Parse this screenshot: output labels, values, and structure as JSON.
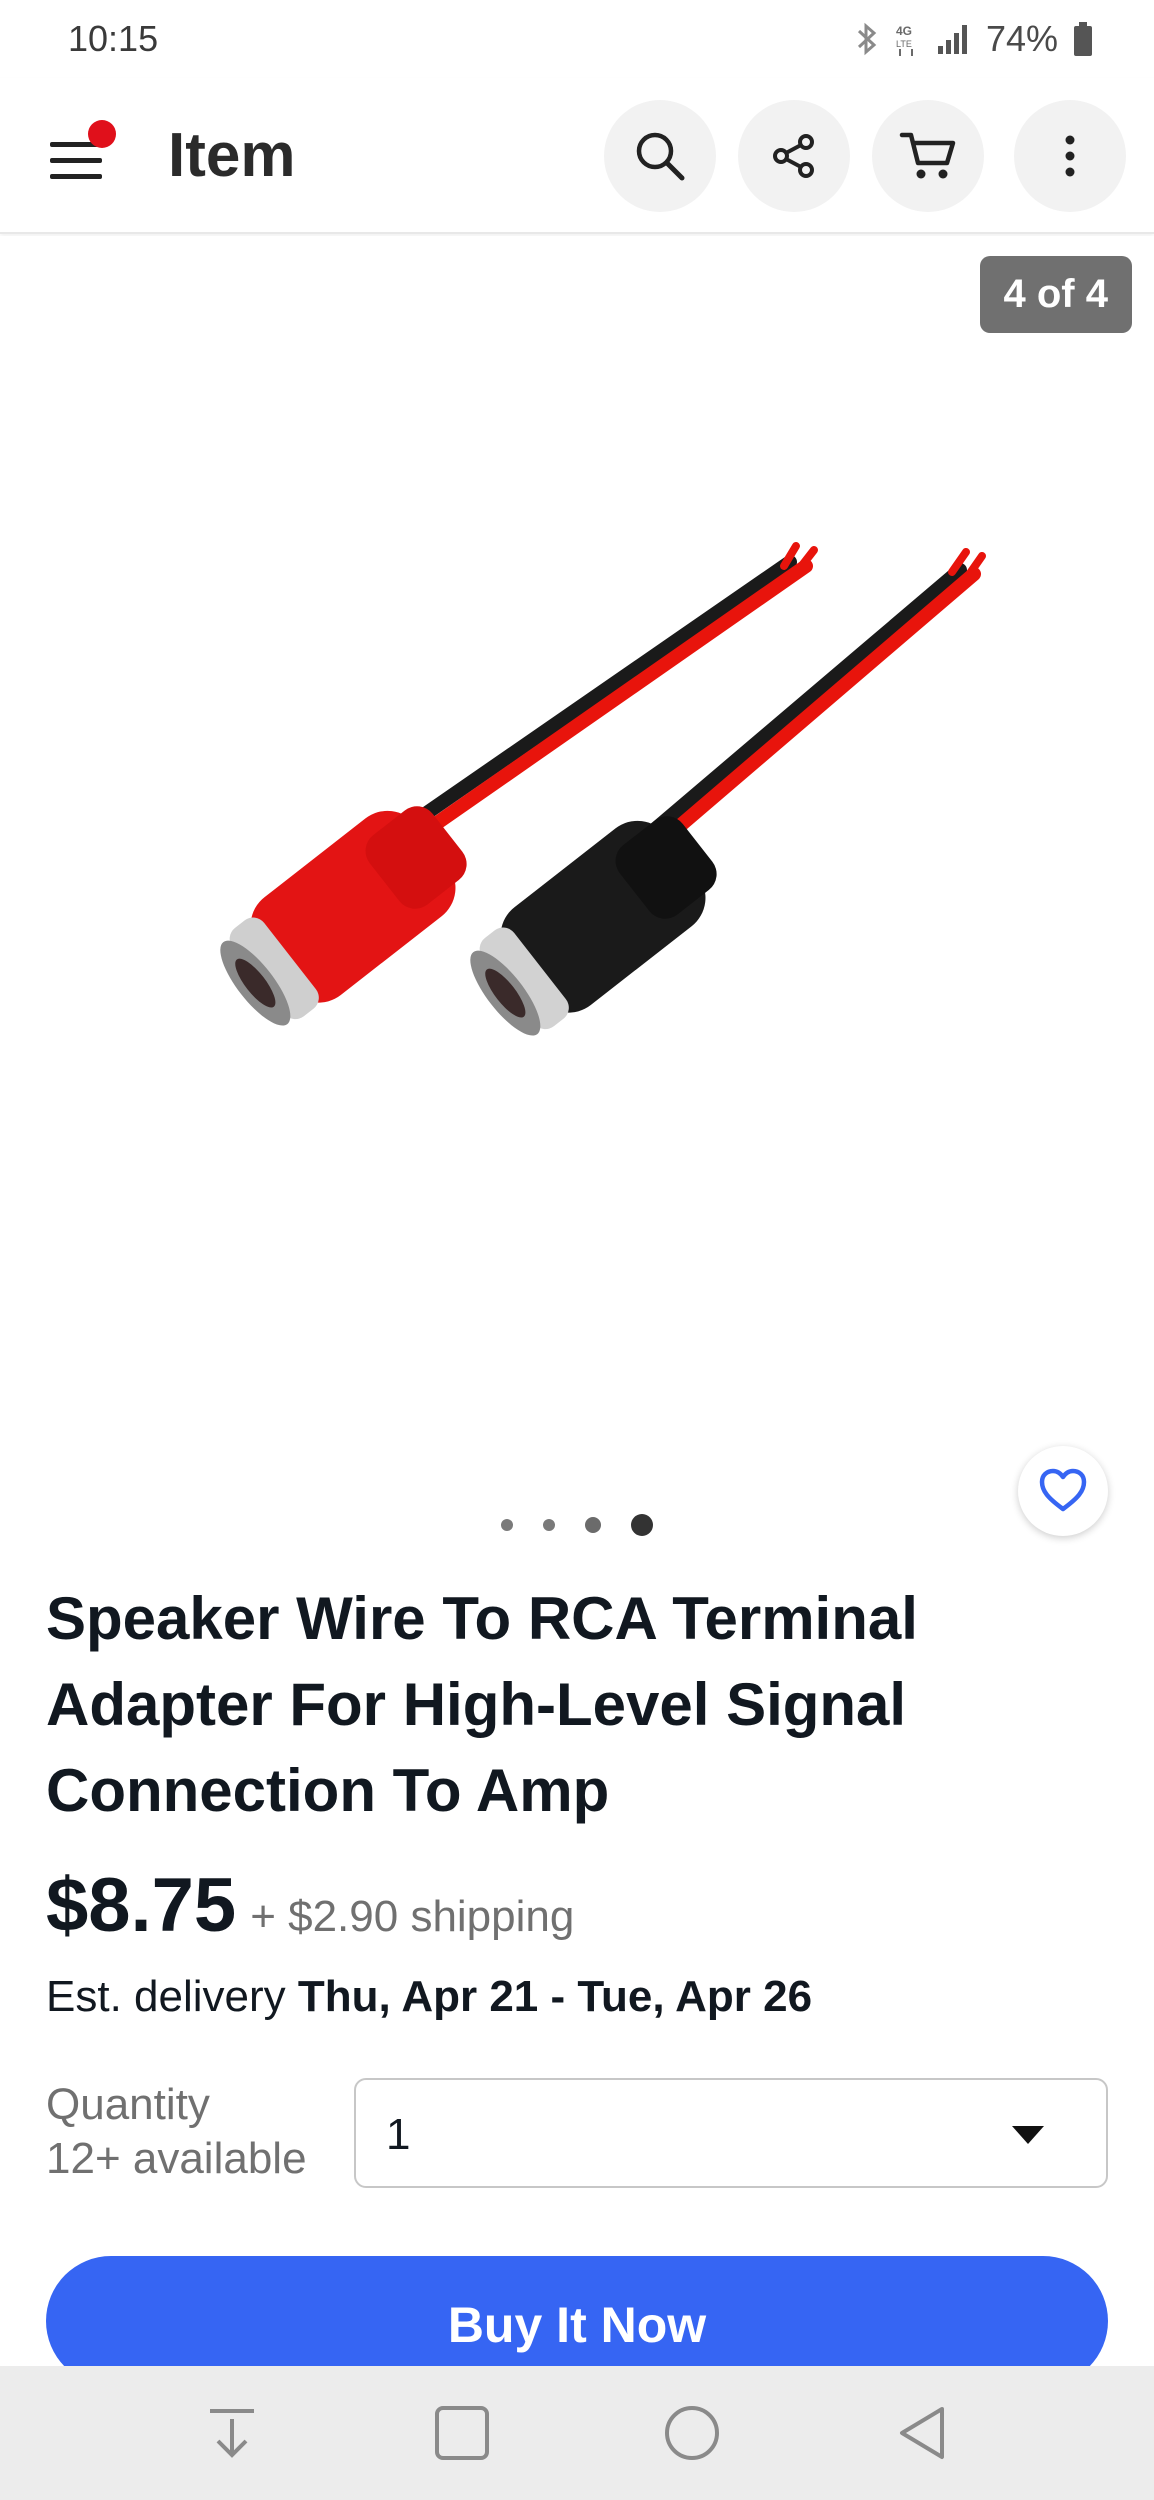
{
  "status_bar": {
    "time": "10:15",
    "network": "4G LTE",
    "battery": "74%"
  },
  "app_bar": {
    "title": "Item",
    "icons": [
      "menu-icon",
      "search-icon",
      "share-icon",
      "cart-icon",
      "more-vert-icon"
    ]
  },
  "gallery": {
    "counter": "4 of 4",
    "current_index": 4,
    "total_images": 4,
    "favorite_icon": "heart-outline-icon"
  },
  "product": {
    "title": "Speaker Wire To RCA Terminal Adapter For High-Level Signal Connection To Amp",
    "price": "$8.75",
    "shipping": "+ $2.90 shipping",
    "delivery_prefix": "Est. delivery ",
    "delivery_dates": "Thu, Apr 21 - Tue, Apr 26"
  },
  "quantity": {
    "label": "Quantity",
    "available": "12+ available",
    "value": "1"
  },
  "actions": {
    "buy_now": "Buy It Now"
  },
  "nav_bar": {
    "icons": [
      "download-nav-icon",
      "recents-nav-icon",
      "home-nav-icon",
      "back-nav-icon"
    ]
  },
  "colors": {
    "accent_blue": "#3665f3",
    "notification_red": "#e0101b",
    "counter_bg": "#707070"
  }
}
